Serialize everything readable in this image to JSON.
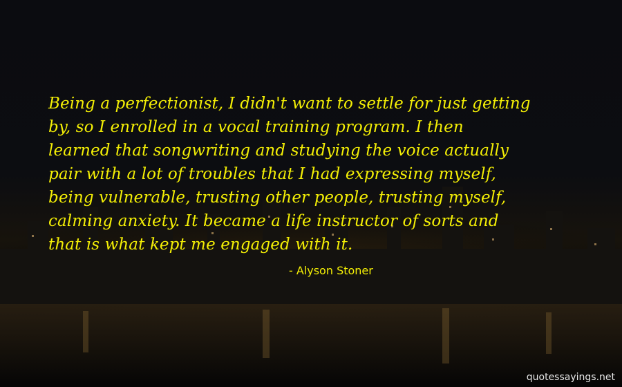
{
  "quote": {
    "lines": [
      "Being a perfectionist, I didn't want to settle for just getting",
      "by, so I enrolled in a vocal training program. I then",
      "learned that songwriting and studying the voice actually",
      "pair with a lot of troubles that I had expressing myself,",
      "being vulnerable, trusting other people, trusting myself,",
      "calming anxiety. It became a life instructor of sorts and",
      "that is what kept me engaged with it."
    ],
    "author": "- Alyson Stoner"
  },
  "watermark": "quotessayings.net",
  "colors": {
    "quote_text": "#f4ef05",
    "author_text": "#f4ef05",
    "watermark_text": "#e8e8e8",
    "background": "#0b0c10"
  }
}
